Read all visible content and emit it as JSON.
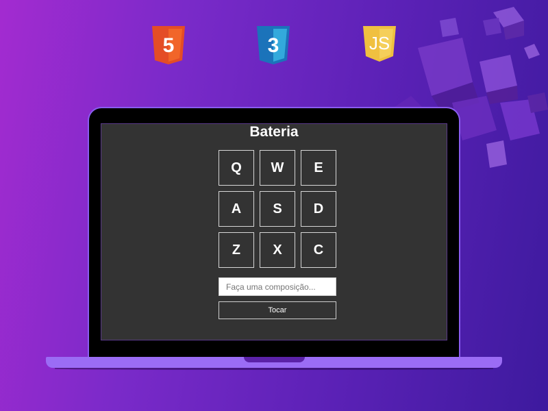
{
  "logos": [
    {
      "name": "html5",
      "icon": "html5-shield-icon",
      "glyph": "5",
      "color": "#e44d26"
    },
    {
      "name": "css3",
      "icon": "css3-shield-icon",
      "glyph": "3",
      "color": "#1b73ba"
    },
    {
      "name": "js",
      "icon": "js-shield-icon",
      "glyph": "JS",
      "color": "#f0c040"
    }
  ],
  "app": {
    "title": "Bateria",
    "pads": [
      {
        "key": "Q"
      },
      {
        "key": "W"
      },
      {
        "key": "E"
      },
      {
        "key": "A"
      },
      {
        "key": "S"
      },
      {
        "key": "D"
      },
      {
        "key": "Z"
      },
      {
        "key": "X"
      },
      {
        "key": "C"
      }
    ],
    "composition": {
      "placeholder": "Faça uma composição...",
      "value": ""
    },
    "play_button_label": "Tocar"
  },
  "colors": {
    "screen_bg": "#333333",
    "accent": "#9b6cf5",
    "background_from": "#a32bd0",
    "background_to": "#3d1a9e"
  }
}
